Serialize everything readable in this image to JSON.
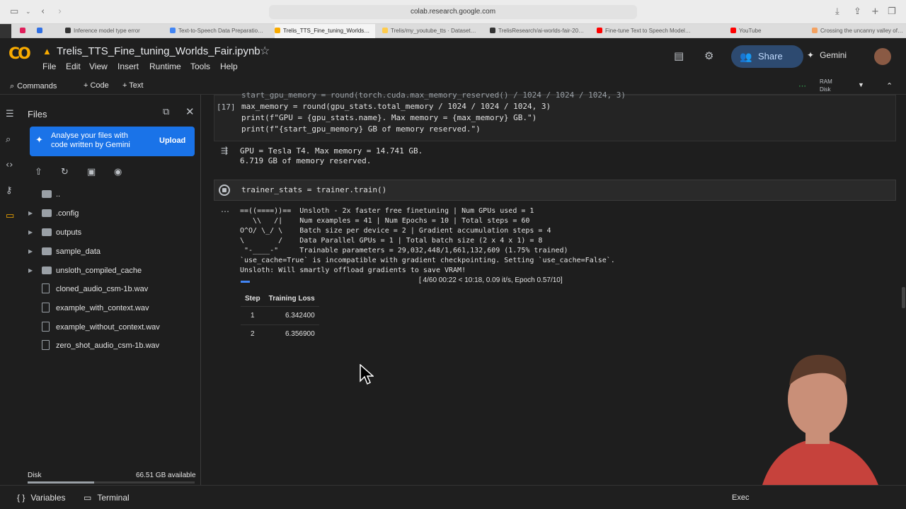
{
  "browser": {
    "url": "colab.research.google.com",
    "tabs": [
      "Inference model type error",
      "Text-to-Speech Data Preparatio…",
      "Trelis_TTS_Fine_tuning_Worlds…",
      "Trelis/my_youtube_tts · Dataset…",
      "TrelisResearch/ai-worlds-fair-20…",
      "Fine-tune Text to Speech Model…",
      "YouTube",
      "Crossing the uncanny valley of…"
    ]
  },
  "header": {
    "title": "Trelis_TTS_Fine_tuning_Worlds_Fair.ipynb",
    "menu": [
      "File",
      "Edit",
      "View",
      "Insert",
      "Runtime",
      "Tools",
      "Help"
    ],
    "share_label": "Share",
    "gemini_label": "Gemini"
  },
  "commandbar": {
    "commands_label": "Commands",
    "code_label": "+ Code",
    "text_label": "+ Text",
    "ram_label": "RAM",
    "disk_label": "Disk"
  },
  "files": {
    "title": "Files",
    "gemini_card_text": "Analyse your files with code written by Gemini",
    "upload_label": "Upload",
    "tree": [
      {
        "name": "..",
        "type": "folder",
        "expandable": false
      },
      {
        "name": ".config",
        "type": "folder",
        "expandable": true
      },
      {
        "name": "outputs",
        "type": "folder",
        "expandable": true
      },
      {
        "name": "sample_data",
        "type": "folder",
        "expandable": true
      },
      {
        "name": "unsloth_compiled_cache",
        "type": "folder",
        "expandable": true
      },
      {
        "name": "cloned_audio_csm-1b.wav",
        "type": "file",
        "expandable": false
      },
      {
        "name": "example_with_context.wav",
        "type": "file",
        "expandable": false
      },
      {
        "name": "example_without_context.wav",
        "type": "file",
        "expandable": false
      },
      {
        "name": "zero_shot_audio_csm-1b.wav",
        "type": "file",
        "expandable": false
      }
    ],
    "disk_label": "Disk",
    "disk_available": "66.51 GB available",
    "disk_used_fraction": 0.4
  },
  "cell17": {
    "exec_count": "[17]",
    "code_lines": [
      "start_gpu_memory = round(torch.cuda.max_memory_reserved() / 1024 / 1024 / 1024, 3)",
      "max_memory = round(gpu_stats.total_memory / 1024 / 1024 / 1024, 3)",
      "print(f\"GPU = {gpu_stats.name}. Max memory = {max_memory} GB.\")",
      "print(f\"{start_gpu_memory} GB of memory reserved.\")"
    ],
    "output_lines": [
      "GPU = Tesla T4. Max memory = 14.741 GB.",
      "6.719 GB of memory reserved."
    ]
  },
  "train_cell": {
    "code": "trainer_stats = trainer.train()",
    "log_lines": [
      "==((====))==  Unsloth - 2x faster free finetuning | Num GPUs used = 1",
      "   \\\\   /|    Num examples = 41 | Num Epochs = 10 | Total steps = 60",
      "O^O/ \\_/ \\    Batch size per device = 2 | Gradient accumulation steps = 4",
      "\\        /    Data Parallel GPUs = 1 | Total batch size (2 x 4 x 1) = 8",
      " \"-____-\"     Trainable parameters = 29,032,448/1,661,132,609 (1.75% trained)",
      "`use_cache=True` is incompatible with gradient checkpointing. Setting `use_cache=False`.",
      "Unsloth: Will smartly offload gradients to save VRAM!"
    ],
    "progress_text": "[ 4/60 00:22 < 10:18, 0.09 it/s, Epoch 0.57/10]",
    "progress_fraction": 0.0667,
    "table_headers": [
      "Step",
      "Training Loss"
    ],
    "table_rows": [
      [
        "1",
        "6.342400"
      ],
      [
        "2",
        "6.356900"
      ]
    ]
  },
  "bottombar": {
    "variables_label": "Variables",
    "terminal_label": "Terminal",
    "exec_status": "Exec"
  }
}
